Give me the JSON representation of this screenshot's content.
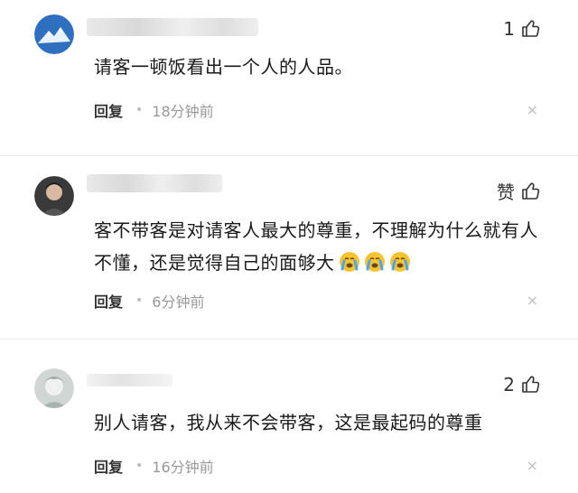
{
  "comments": [
    {
      "likes": "1",
      "text": "请客一顿饭看出一个人的人品。",
      "reply_label": "回复",
      "time": "18分钟前",
      "close_glyph": "×"
    },
    {
      "likes": "赞",
      "text": "客不带客是对请客人最大的尊重，不理解为什么就有人不懂，还是觉得自己的面够大",
      "emoji": [
        "crying-face-emoji",
        "crying-face-emoji",
        "crying-face-emoji"
      ],
      "reply_label": "回复",
      "time": "6分钟前",
      "close_glyph": "×"
    },
    {
      "likes": "2",
      "text": "别人请客，我从来不会带客，这是最起码的尊重",
      "reply_label": "回复",
      "time": "16分钟前",
      "close_glyph": "×"
    }
  ],
  "colors": {
    "accent_icon": "#333333",
    "meta_gray": "#999999",
    "divider": "#ececec"
  }
}
